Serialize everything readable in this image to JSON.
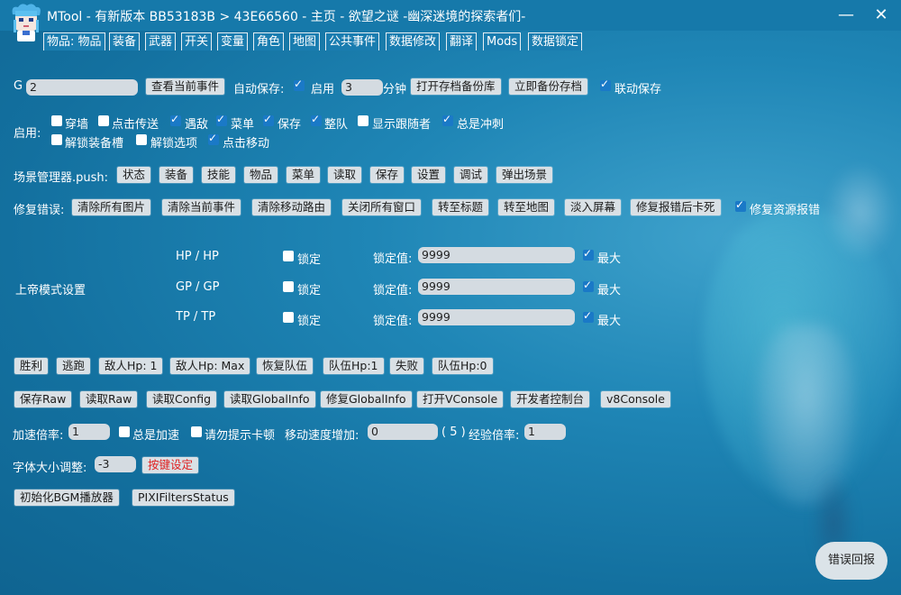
{
  "window": {
    "title": "MTool - 有新版本 BB53183B > 43E66560 - 主页 - 欲望之谜 -幽深迷境的探索者们-",
    "minimize_glyph": "—",
    "close_glyph": "✕"
  },
  "tabs": [
    "物品: 物品",
    "装备",
    "武器",
    "开关",
    "变量",
    "角色",
    "地图",
    "公共事件",
    "数据修改",
    "翻译",
    "Mods",
    "数据锁定"
  ],
  "row_g": {
    "label": "G",
    "value": "2",
    "view_event": "查看当前事件",
    "autosave_label": "自动保存:",
    "enable_label": "启用",
    "interval_value": "3",
    "minutes_label": "分钟",
    "open_backup": "打开存档备份库",
    "backup_now": "立即备份存档",
    "linked_save": "联动保存"
  },
  "enable_section": {
    "label": "启用:",
    "options": [
      {
        "label": "穿墙",
        "checked": false
      },
      {
        "label": "点击传送",
        "checked": false
      },
      {
        "label": "遇敌",
        "checked": true
      },
      {
        "label": "菜单",
        "checked": true
      },
      {
        "label": "保存",
        "checked": true
      },
      {
        "label": "整队",
        "checked": true
      },
      {
        "label": "显示跟随者",
        "checked": false
      },
      {
        "label": "总是冲刺",
        "checked": true
      },
      {
        "label": "解锁装备槽",
        "checked": false
      },
      {
        "label": "解锁选项",
        "checked": false
      },
      {
        "label": "点击移动",
        "checked": true
      }
    ]
  },
  "scene_manager": {
    "label": "场景管理器.push:",
    "buttons": [
      "状态",
      "装备",
      "技能",
      "物品",
      "菜单",
      "读取",
      "保存",
      "设置",
      "调试",
      "弹出场景"
    ]
  },
  "fix_errors": {
    "label": "修复错误:",
    "buttons": [
      "清除所有图片",
      "清除当前事件",
      "清除移动路由",
      "关闭所有窗口",
      "转至标题",
      "转至地图",
      "淡入屏幕",
      "修复报错后卡死"
    ],
    "resource_fix": "修复资源报错"
  },
  "god_mode": {
    "label": "上帝模式设置",
    "rows": [
      {
        "stat": "HP / HP",
        "lock": "锁定",
        "lock_value_label": "锁定值:",
        "value": "9999",
        "max": "最大"
      },
      {
        "stat": "GP / GP",
        "lock": "锁定",
        "lock_value_label": "锁定值:",
        "value": "9999",
        "max": "最大"
      },
      {
        "stat": "TP / TP",
        "lock": "锁定",
        "lock_value_label": "锁定值:",
        "value": "9999",
        "max": "最大"
      }
    ]
  },
  "battle_buttons": [
    "胜利",
    "逃跑",
    "敌人Hp: 1",
    "敌人Hp: Max",
    "恢复队伍",
    "队伍Hp:1",
    "失败",
    "队伍Hp:0"
  ],
  "debug_buttons": [
    "保存Raw",
    "读取Raw",
    "读取Config",
    "读取GlobalInfo",
    "修复GlobalInfo",
    "打开VConsole",
    "开发者控制台",
    "v8Console"
  ],
  "speed_row": {
    "accel_label": "加速倍率:",
    "accel_value": "1",
    "always_accel": "总是加速",
    "no_lag_hint": "请勿提示卡顿",
    "move_speed_label": "移动速度增加:",
    "move_speed_value": "0",
    "move_speed_display": "( 5 )",
    "exp_label": "经验倍率:",
    "exp_value": "1"
  },
  "font_row": {
    "label": "字体大小调整:",
    "value": "-3",
    "keybind": "按键设定"
  },
  "misc_buttons": [
    "初始化BGM播放器",
    "PIXIFiltersStatus"
  ],
  "report_button": "错误回报",
  "colors": {
    "background": "#1679aa",
    "accent_red": "#e02020",
    "button": "#d9e0e5"
  }
}
